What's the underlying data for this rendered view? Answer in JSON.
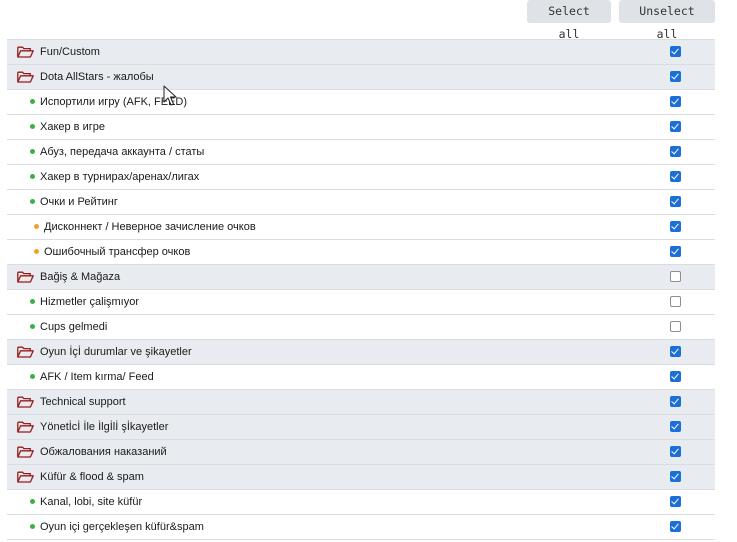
{
  "toolbar": {
    "select_all_label": "Select all",
    "unselect_all_label": "Unselect all"
  },
  "colors": {
    "group_bg": "#e8ebef",
    "folder_icon": "#9b1b1b",
    "dot_level1": "#3cb043",
    "dot_level2": "#f0a030",
    "checkbox_checked": "#1b6fd6"
  },
  "rows": [
    {
      "type": "group",
      "label": "Fun/Custom",
      "checked": true
    },
    {
      "type": "group",
      "label": "Dota AllStars - жалобы",
      "checked": true
    },
    {
      "type": "item",
      "level": 1,
      "label": "Испортили игру (AFK, FEED)",
      "checked": true
    },
    {
      "type": "item",
      "level": 1,
      "label": "Хакер в игре",
      "checked": true
    },
    {
      "type": "item",
      "level": 1,
      "label": "Абуз, передача аккаунта / статы",
      "checked": true
    },
    {
      "type": "item",
      "level": 1,
      "label": "Хакер в турнирах/аренах/лигах",
      "checked": true
    },
    {
      "type": "item",
      "level": 1,
      "label": "Очки и Рейтинг",
      "checked": true
    },
    {
      "type": "item",
      "level": 2,
      "label": "Дисконнект / Неверное зачисление очков",
      "checked": true
    },
    {
      "type": "item",
      "level": 2,
      "label": "Ошибочный трансфер очков",
      "checked": true
    },
    {
      "type": "group",
      "label": "Bağiş & Mağaza",
      "checked": false
    },
    {
      "type": "item",
      "level": 1,
      "label": "Hizmetler çalişmıyor",
      "checked": false
    },
    {
      "type": "item",
      "level": 1,
      "label": "Cups gelmedi",
      "checked": false
    },
    {
      "type": "group",
      "label": "Oyun İçİ durumlar ve şikayetler",
      "checked": true
    },
    {
      "type": "item",
      "level": 1,
      "label": "AFK / Item kırma/ Feed",
      "checked": true
    },
    {
      "type": "group",
      "label": "Technical support",
      "checked": true
    },
    {
      "type": "group",
      "label": "Yönetİcİ İle İlgİlİ şİkayetler",
      "checked": true
    },
    {
      "type": "group",
      "label": "Обжалования наказаний",
      "checked": true
    },
    {
      "type": "group",
      "label": "Küfür & flood & spam",
      "checked": true
    },
    {
      "type": "item",
      "level": 1,
      "label": "Kanal, lobi, site küfür",
      "checked": true
    },
    {
      "type": "item",
      "level": 1,
      "label": "Oyun içi gerçekleşen küfür&spam",
      "checked": true
    }
  ]
}
